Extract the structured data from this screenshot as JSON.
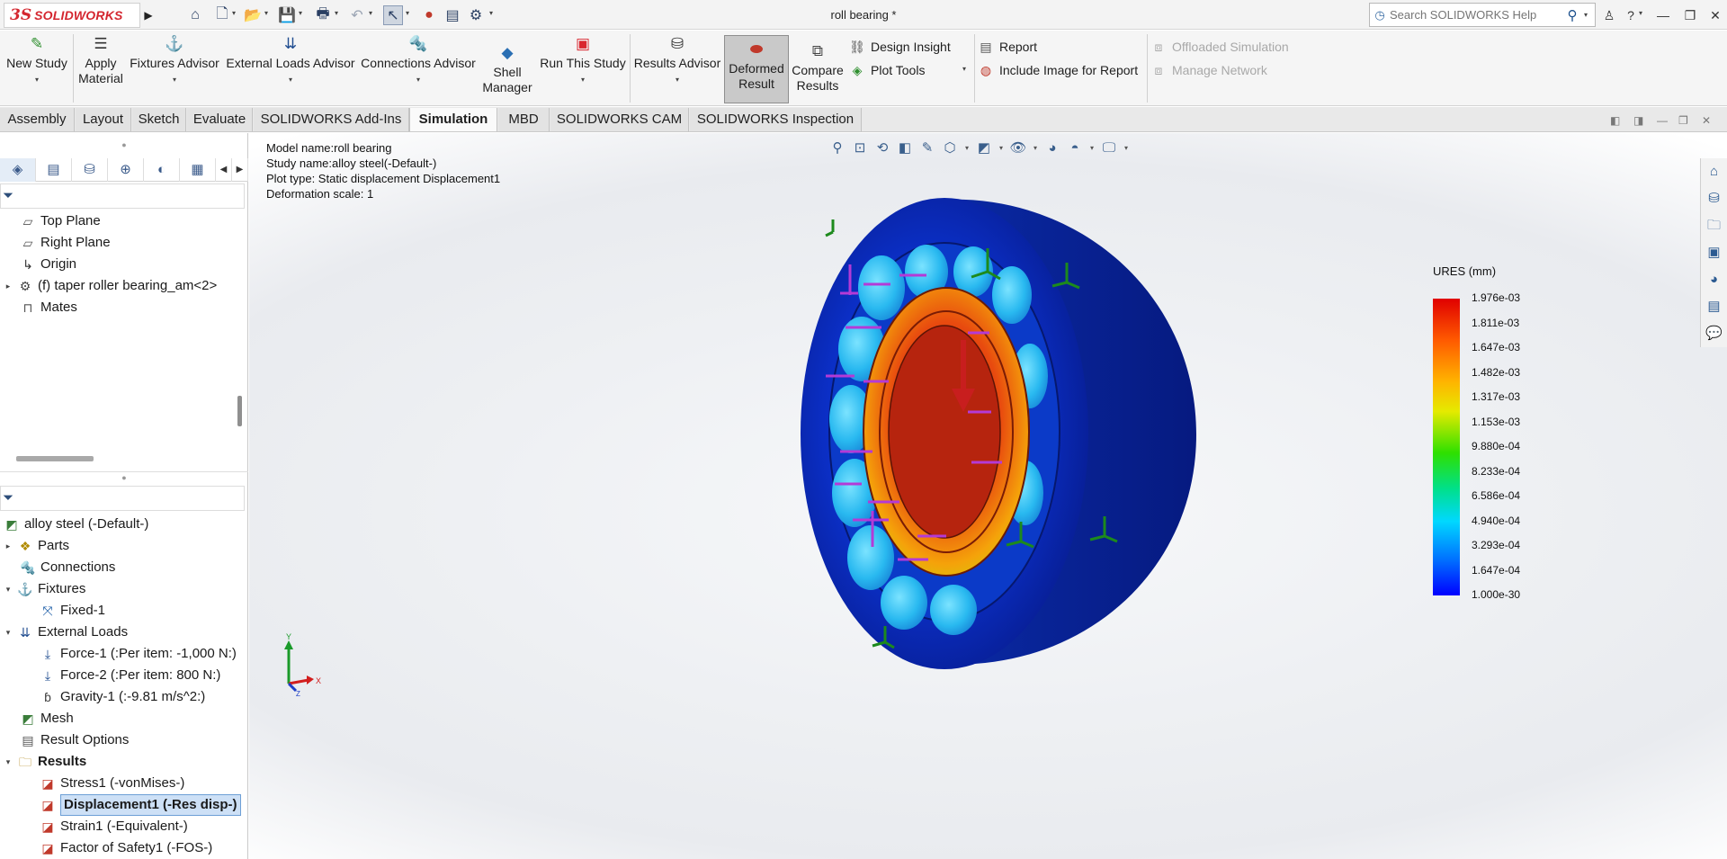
{
  "app": {
    "logo_ds": "3S",
    "logo_name": "SOLIDWORKS",
    "document_title": "roll bearing *",
    "search_placeholder": "Search SOLIDWORKS Help"
  },
  "ribbon": {
    "new_study": "New Study",
    "apply_material_1": "Apply",
    "apply_material_2": "Material",
    "fixtures_advisor": "Fixtures Advisor",
    "external_loads_advisor": "External Loads Advisor",
    "connections_advisor": "Connections Advisor",
    "shell_manager_1": "Shell",
    "shell_manager_2": "Manager",
    "run_this_study": "Run This Study",
    "results_advisor": "Results Advisor",
    "deformed_result_1": "Deformed",
    "deformed_result_2": "Result",
    "compare_results_1": "Compare",
    "compare_results_2": "Results",
    "design_insight": "Design Insight",
    "plot_tools": "Plot Tools",
    "report": "Report",
    "include_image": "Include Image for Report",
    "offloaded_simulation": "Offloaded Simulation",
    "manage_network": "Manage Network"
  },
  "tabs": [
    "Assembly",
    "Layout",
    "Sketch",
    "Evaluate",
    "SOLIDWORKS Add-Ins",
    "Simulation",
    "MBD",
    "SOLIDWORKS CAM",
    "SOLIDWORKS Inspection"
  ],
  "active_tab": "Simulation",
  "feature_tree": {
    "top_plane": "Top Plane",
    "right_plane": "Right Plane",
    "origin": "Origin",
    "component": "(f) taper roller bearing_am<2>",
    "mates": "Mates"
  },
  "study_tree": {
    "study": "alloy steel (-Default-)",
    "parts": "Parts",
    "connections": "Connections",
    "fixtures": "Fixtures",
    "fixed_1": "Fixed-1",
    "external_loads": "External Loads",
    "force_1": "Force-1 (:Per item: -1,000 N:)",
    "force_2": "Force-2 (:Per item: 800 N:)",
    "gravity_1": "Gravity-1 (:-9.81 m/s^2:)",
    "mesh": "Mesh",
    "result_options": "Result Options",
    "results": "Results",
    "stress1": "Stress1 (-vonMises-)",
    "displacement1": "Displacement1 (-Res disp-)",
    "strain1": "Strain1 (-Equivalent-)",
    "fos1": "Factor of Safety1 (-FOS-)"
  },
  "viewport_info": {
    "model_name": "Model name:roll bearing",
    "study_name": "Study name:alloy steel(-Default-)",
    "plot_type": "Plot type: Static displacement Displacement1",
    "deformation_scale": "Deformation scale: 1"
  },
  "legend": {
    "title": "URES (mm)",
    "ticks": [
      "1.976e-03",
      "1.811e-03",
      "1.647e-03",
      "1.482e-03",
      "1.317e-03",
      "1.153e-03",
      "9.880e-04",
      "8.233e-04",
      "6.586e-04",
      "4.940e-04",
      "3.293e-04",
      "1.647e-04",
      "1.000e-30"
    ]
  },
  "triad": {
    "y": "Y",
    "x": "X",
    "z": "Z"
  },
  "colors": {
    "brand_red": "#d4262f",
    "selection": "#cde0f6",
    "active_ribbon": "#c9c9c9",
    "outer_ring": "#0b2fbf",
    "inner_ring_hot": "#e8420c",
    "load_arrow": "#b43ad6",
    "fixture_arrow": "#1d8a1d"
  }
}
